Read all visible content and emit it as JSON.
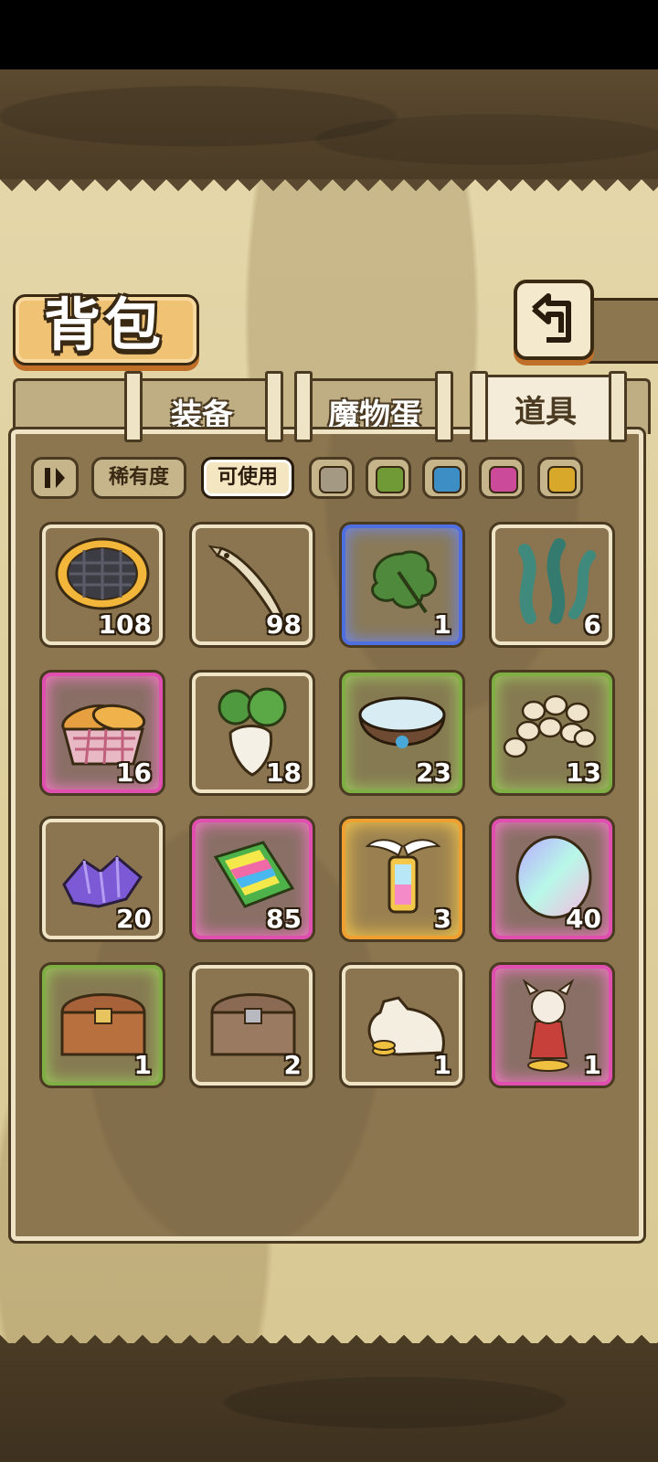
{
  "header": {
    "title": "背包"
  },
  "tabs": [
    {
      "label": "装备",
      "active": false
    },
    {
      "label": "魔物蛋",
      "active": false
    },
    {
      "label": "道具",
      "active": true
    }
  ],
  "filters": {
    "rarity_label": "稀有度",
    "usable_label": "可使用",
    "color_swatches": [
      "#a49a84",
      "#6f9a36",
      "#3e8ec6",
      "#cc4a9a",
      "#d7a82a"
    ]
  },
  "items": [
    {
      "name": "waffle-ring",
      "count": "108",
      "rarity": "common"
    },
    {
      "name": "dried-fish",
      "count": "98",
      "rarity": "common"
    },
    {
      "name": "herb-leaf",
      "count": "1",
      "rarity": "blue"
    },
    {
      "name": "seaweed",
      "count": "6",
      "rarity": "common"
    },
    {
      "name": "bread-basket",
      "count": "16",
      "rarity": "pink"
    },
    {
      "name": "radish",
      "count": "18",
      "rarity": "common"
    },
    {
      "name": "water-bowl",
      "count": "23",
      "rarity": "green"
    },
    {
      "name": "pebbles",
      "count": "13",
      "rarity": "green"
    },
    {
      "name": "purple-crystals",
      "count": "20",
      "rarity": "common"
    },
    {
      "name": "rainbow-book",
      "count": "85",
      "rarity": "pink"
    },
    {
      "name": "winged-lantern",
      "count": "3",
      "rarity": "orange"
    },
    {
      "name": "rainbow-egg",
      "count": "40",
      "rarity": "pink"
    },
    {
      "name": "wooden-chest",
      "count": "1",
      "rarity": "green"
    },
    {
      "name": "iron-chest",
      "count": "2",
      "rarity": "common"
    },
    {
      "name": "coin-sack",
      "count": "1",
      "rarity": "common"
    },
    {
      "name": "character-figure",
      "count": "1",
      "rarity": "pink"
    }
  ]
}
